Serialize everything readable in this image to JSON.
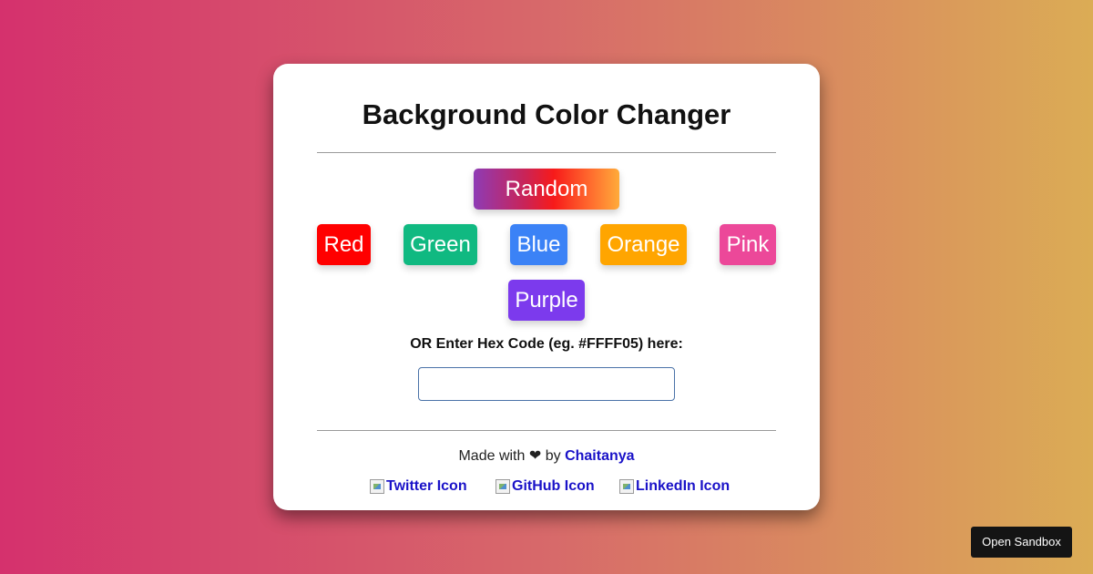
{
  "app": {
    "title": "Background Color Changer",
    "background_gradient": [
      "#d5316d",
      "#d7696a",
      "#dbac55"
    ]
  },
  "buttons": {
    "random": {
      "label": "Random"
    },
    "colors": [
      {
        "label": "Red",
        "color": "#ff0000"
      },
      {
        "label": "Green",
        "color": "#10b981"
      },
      {
        "label": "Blue",
        "color": "#3b82f6"
      },
      {
        "label": "Orange",
        "color": "#ffa500"
      },
      {
        "label": "Pink",
        "color": "#ec4899"
      },
      {
        "label": "Purple",
        "color": "#7c3aed"
      }
    ]
  },
  "hex": {
    "label": "OR Enter Hex Code (eg. #FFFF05) here:",
    "value": "",
    "placeholder": ""
  },
  "footer": {
    "made_with": "Made with",
    "heart": "❤",
    "by": "by",
    "author": "Chaitanya",
    "links": [
      {
        "label": "Twitter Icon",
        "icon": "broken-image-icon"
      },
      {
        "label": "GitHub Icon",
        "icon": "broken-image-icon"
      },
      {
        "label": "LinkedIn Icon",
        "icon": "broken-image-icon"
      }
    ]
  },
  "sandbox": {
    "label": "Open Sandbox"
  }
}
